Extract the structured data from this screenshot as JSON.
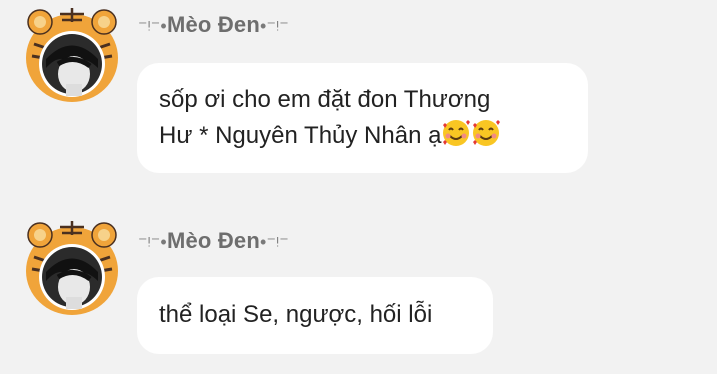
{
  "messages": [
    {
      "sender": "Mèo Đen",
      "sender_prefix": "⁻ᵎ⁻•",
      "sender_suffix": "•⁻ᵎ⁻",
      "text_line1": "sốp ơi cho em đặt đon Thương",
      "text_line2": "Hư * Nguyên Thủy Nhân ạ",
      "emojis": [
        "smiling-face-with-hearts",
        "smiling-face-with-hearts"
      ]
    },
    {
      "sender": "Mèo Đen",
      "sender_prefix": "⁻ᵎ⁻•",
      "sender_suffix": "•⁻ᵎ⁻",
      "text_line1": "thể loại Se, ngược, hối lỗi"
    }
  ],
  "colors": {
    "background": "#f2f2f2",
    "bubble": "#ffffff",
    "sender_text": "#6e6e6e",
    "message_text": "#222222",
    "avatar_frame": "#f0a43a"
  }
}
